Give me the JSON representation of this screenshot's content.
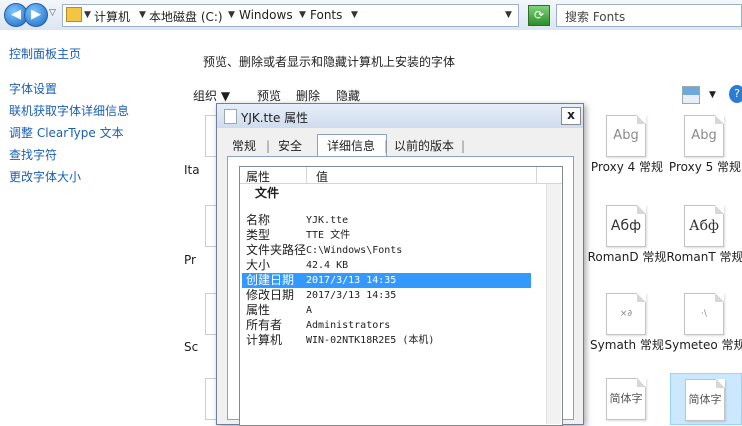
{
  "address_bar": {
    "crumbs": [
      "计算机",
      "本地磁盘 (C:)",
      "Windows",
      "Fonts"
    ],
    "search_placeholder": "搜索 Fonts"
  },
  "left_nav": {
    "items": [
      "控制面板主页",
      "字体设置",
      "联机获取字体详细信息",
      "调整 ClearType 文本",
      "查找字符",
      "更改字体大小"
    ]
  },
  "main": {
    "description": "预览、删除或者显示和隐藏计算机上安装的字体",
    "toolbar": {
      "organize": "组织",
      "preview": "预览",
      "delete": "删除",
      "hide": "隐藏"
    },
    "partial_labels": [
      "Ita",
      "Pr",
      "Sc"
    ]
  },
  "fonts": [
    {
      "glyph": "Abg",
      "name": "Proxy 4 常规"
    },
    {
      "glyph": "Abg",
      "name": "Proxy 5 常规"
    },
    {
      "glyph": "Абф",
      "name": "RomanD 常规"
    },
    {
      "glyph": "Абф",
      "name": "RomanT 常规"
    },
    {
      "glyph": "×∂",
      "name": "Symath 常规"
    },
    {
      "glyph": "·\\",
      "name": "Symeteo 常规"
    },
    {
      "glyph": "简体字",
      "name": ""
    },
    {
      "glyph": "简体字",
      "name": ""
    }
  ],
  "dialog": {
    "title": "YJK.tte 属性",
    "close": "x",
    "tabs": [
      "常规",
      "安全",
      "详细信息",
      "以前的版本"
    ],
    "columns": {
      "property": "属性",
      "value": "值"
    },
    "section": "文件",
    "rows": [
      {
        "key": "名称",
        "value": "YJK.tte"
      },
      {
        "key": "类型",
        "value": "TTE 文件"
      },
      {
        "key": "文件夹路径",
        "value": "C:\\Windows\\Fonts"
      },
      {
        "key": "大小",
        "value": "42.4 KB"
      },
      {
        "key": "创建日期",
        "value": "2017/3/13 14:35",
        "selected": true
      },
      {
        "key": "修改日期",
        "value": "2017/3/13 14:35"
      },
      {
        "key": "属性",
        "value": "A"
      },
      {
        "key": "所有者",
        "value": "Administrators"
      },
      {
        "key": "计算机",
        "value": "WIN-02NTK18R2E5 (本机)"
      }
    ]
  },
  "colors": {
    "link": "#1a5fb4",
    "selection": "#3399ff"
  }
}
